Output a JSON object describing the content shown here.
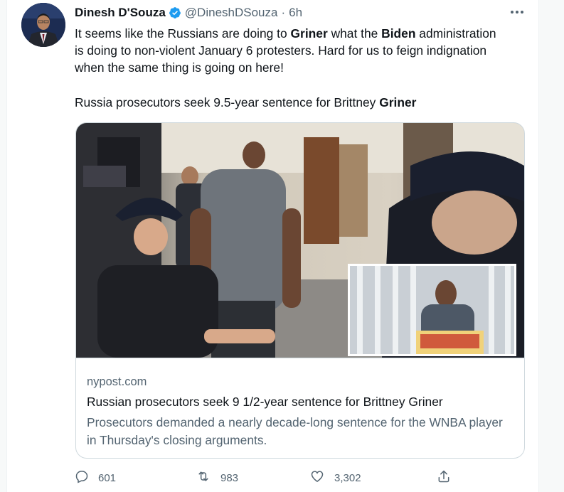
{
  "tweet": {
    "author_name": "Dinesh D'Souza",
    "handle": "@DineshDSouza",
    "separator": "·",
    "time": "6h",
    "text_parts": [
      "It seems like the Russians are doing to ",
      "Griner",
      " what the ",
      "Biden",
      " administration is doing to non-violent January 6 protesters. Hard for us to feign indignation when the same thing is going on here!"
    ],
    "link_text_prefix": "Russia prosecutors seek 9.5-year sentence for Brittney ",
    "link_text_bold": "Griner"
  },
  "card": {
    "domain": "nypost.com",
    "title": "Russian prosecutors seek 9 1/2-year sentence for Brittney Griner",
    "description": "Prosecutors demanded a nearly decade-long sentence for the WNBA player in Thursday's closing arguments."
  },
  "actions": {
    "replies": "601",
    "retweets": "983",
    "likes": "3,302"
  },
  "colors": {
    "verified": "#1d9bf0",
    "secondary_text": "#536471",
    "border": "#cfd9de"
  },
  "icons": [
    "verified-badge-icon",
    "more-icon",
    "reply-icon",
    "retweet-icon",
    "like-icon",
    "share-icon"
  ]
}
